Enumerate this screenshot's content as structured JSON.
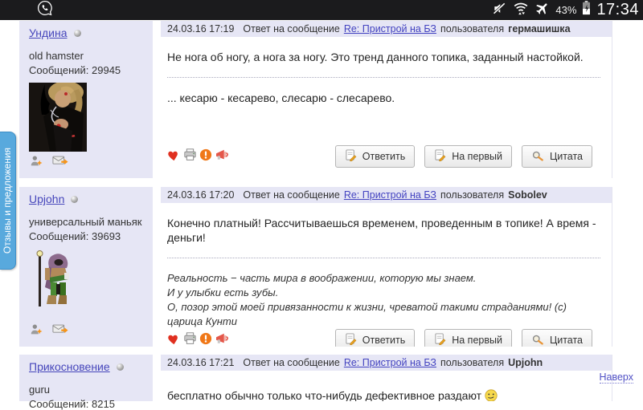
{
  "status_bar": {
    "time": "17:34",
    "battery": "43%"
  },
  "side_tab": {
    "label": "Отзывы и предложения"
  },
  "sidebar": {
    "users": [
      {
        "name": "Ундина",
        "title": "old hamster",
        "posts": "Сообщений: 29945"
      },
      {
        "name": "Upjohn",
        "title": "универсальный маньяк",
        "posts": "Сообщений: 39693"
      },
      {
        "name": "Прикосновение",
        "title": "guru",
        "posts": "Сообщений: 8215"
      }
    ]
  },
  "posts": [
    {
      "date": "24.03.16 17:19",
      "reply_text": "Ответ на сообщение",
      "topic": "Re: Пристрой на БЗ",
      "user_text": "пользователя",
      "author": "гермашишка",
      "para1": "Не нога об ногу, а нога за ногу. Это тренд данного топика, заданный настойкой.",
      "para2": "... кесарю - кесарево, слесарю - слесарево."
    },
    {
      "date": "24.03.16 17:20",
      "reply_text": "Ответ на сообщение",
      "topic": "Re: Пристрой на БЗ",
      "user_text": "пользователя",
      "author": "Sobolev",
      "para1": "Конечно платный! Рассчитываешься временем, проведенным в топике! А время - деньги!",
      "sig1": "Реальность − часть мира в воображении, которую мы знаем.",
      "sig2": "И у улыбки есть зубы.",
      "sig3": "О, позор этой моей привязанности к жизни, чреватой такими страданиями! (с) царица Кунти"
    },
    {
      "date": "24.03.16 17:21",
      "reply_text": "Ответ на сообщение",
      "topic": "Re: Пристрой на БЗ",
      "user_text": "пользователя",
      "author": "Upjohn",
      "para1": "бесплатно обычно только что-нибудь дефективное раздают"
    }
  ],
  "actions": {
    "reply": "Ответить",
    "first": "На первый",
    "quote": "Цитата"
  },
  "to_top": "Наверх",
  "colors": {
    "tab_blue": "#58a9dd",
    "link": "#4646bb",
    "panel": "#e6e6f5",
    "status_bar": "#1b1b1d",
    "heart_red": "#e03020",
    "warning_orange": "#f07818"
  }
}
